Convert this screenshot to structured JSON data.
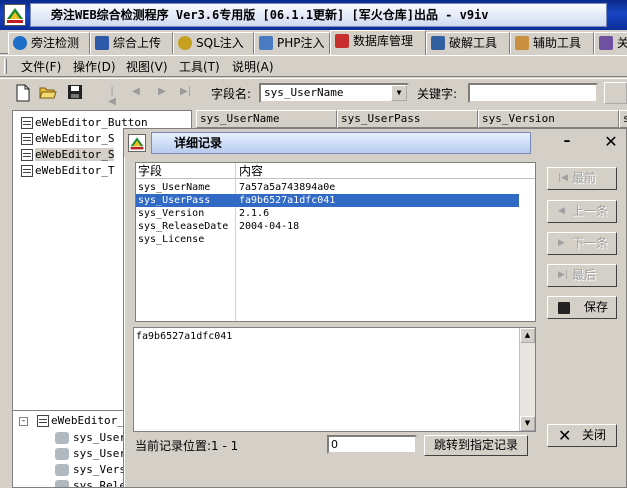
{
  "window": {
    "title": "旁注WEB综合检测程序 Ver3.6专用版 [06.1.1更新] [军火仓库]出品 -  v9iv"
  },
  "tabs": [
    {
      "label": "旁注检测",
      "color": "#1c6ec8"
    },
    {
      "label": "综合上传",
      "color": "#2d5aa8"
    },
    {
      "label": "SQL注入",
      "color": "#c8a020"
    },
    {
      "label": "PHP注入",
      "color": "#4a7ac0"
    },
    {
      "label": "数据库管理",
      "color": "#c83030"
    },
    {
      "label": "破解工具",
      "color": "#3060a0"
    },
    {
      "label": "辅助工具",
      "color": "#c89040"
    },
    {
      "label": "关",
      "color": "#7050a0"
    }
  ],
  "active_tab_index": 4,
  "menu": {
    "items": [
      "文件(F)",
      "操作(D)",
      "视图(V)",
      "工具(T)",
      "说明(A)"
    ]
  },
  "toolbar": {
    "field_label": "字段名:",
    "field_value": "sys_UserName",
    "keyword_label": "关键字:",
    "keyword_value": ""
  },
  "tree": {
    "items": [
      "eWebEditor_Button",
      "eWebEditor_S",
      "eWebEditor_S",
      "eWebEditor_T"
    ],
    "lower_root": "eWebEditor_S",
    "lower_items": [
      "sys_UserN",
      "sys_UserP",
      "sys_Vers",
      "sys_ReleaseDate"
    ]
  },
  "grid": {
    "columns": [
      "sys_UserName",
      "sys_UserPass",
      "sys_Version",
      "s"
    ]
  },
  "dialog": {
    "title": "详细记录",
    "minimize_glyph": "–",
    "close_glyph": "✕",
    "headers": {
      "field": "字段",
      "value": "内容"
    },
    "rows": [
      {
        "field": "sys_UserName",
        "value": "7a57a5a743894a0e"
      },
      {
        "field": "sys_UserPass",
        "value": "fa9b6527a1dfc041"
      },
      {
        "field": "sys_Version",
        "value": "2.1.6"
      },
      {
        "field": "sys_ReleaseDate",
        "value": "2004-04-18"
      },
      {
        "field": "sys_License",
        "value": ""
      }
    ],
    "selected_row_index": 1,
    "detail_text": "fa9b6527a1dfc041",
    "buttons": {
      "first": "最前",
      "prev": "上一条",
      "next": "下一条",
      "last": "最后",
      "save": "保存",
      "close": "关闭"
    },
    "position_label": "当前记录位置:1 - 1",
    "jump_value": "0",
    "jump_button": "跳转到指定记录"
  }
}
